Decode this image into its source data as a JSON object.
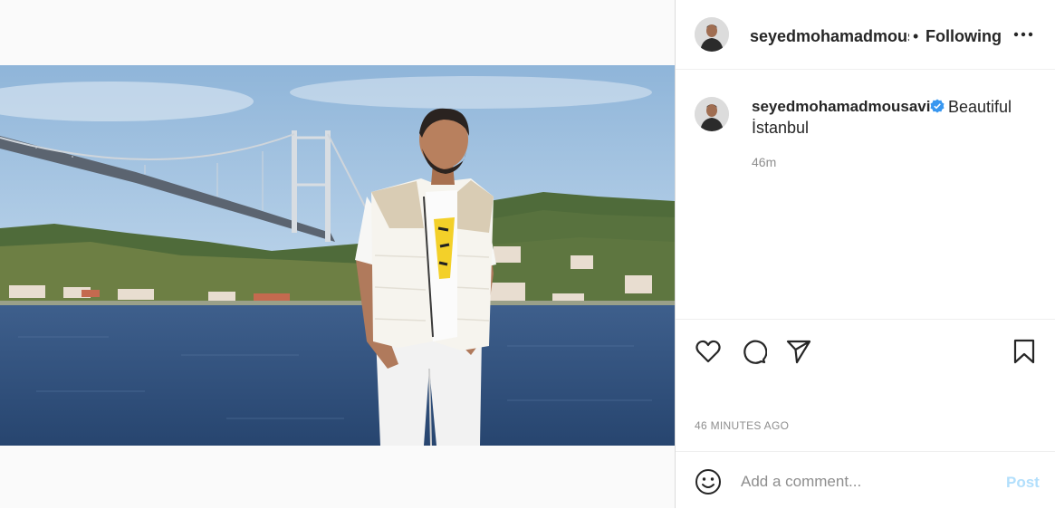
{
  "post": {
    "image_alt": "Man in white vest standing by the Bosphorus with a suspension bridge behind him",
    "header": {
      "username": "seyedmohamadmousavi",
      "separator": "•",
      "follow_status": "Following",
      "more_icon": "more-horizontal-icon"
    },
    "caption": {
      "username": "seyedmohamadmousavi",
      "verified_icon": "verified-badge-icon",
      "text_line1": "Beautiful",
      "text_line2": "İstanbul",
      "time": "46m"
    },
    "actions": {
      "icons": [
        "heart-icon",
        "comment-icon",
        "share-icon",
        "bookmark-icon"
      ]
    },
    "timestamp": "46 MINUTES AGO",
    "comment": {
      "emoji_icon": "emoji-icon",
      "placeholder": "Add a comment...",
      "post_label": "Post"
    }
  },
  "colors": {
    "verified": "#3897f0",
    "post_disabled": "#b2dffc",
    "muted_text": "#8e8e8e"
  }
}
